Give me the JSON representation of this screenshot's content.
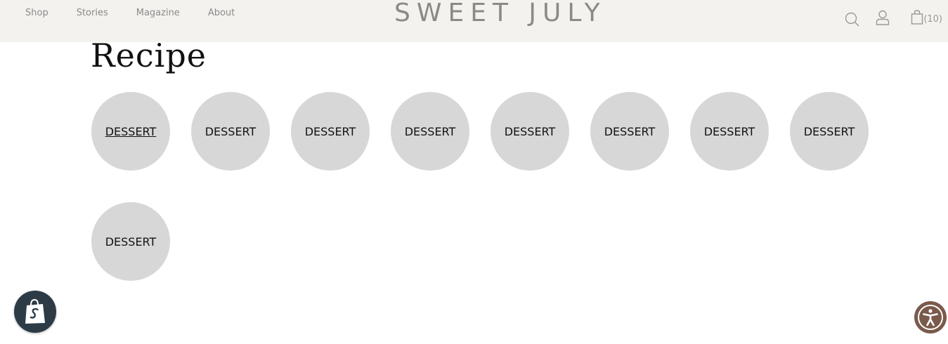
{
  "header": {
    "nav": [
      {
        "label": "Shop"
      },
      {
        "label": "Stories"
      },
      {
        "label": "Magazine"
      },
      {
        "label": "About"
      }
    ],
    "logo": "SWEET JULY",
    "cart_count": "(10)",
    "icons": [
      "search-icon",
      "account-icon",
      "cart-icon"
    ]
  },
  "main": {
    "title": "Recipe",
    "categories": [
      {
        "label": "DESSERT",
        "active": true
      },
      {
        "label": "DESSERT",
        "active": false
      },
      {
        "label": "DESSERT",
        "active": false
      },
      {
        "label": "DESSERT",
        "active": false
      },
      {
        "label": "DESSERT",
        "active": false
      },
      {
        "label": "DESSERT",
        "active": false
      },
      {
        "label": "DESSERT",
        "active": false
      },
      {
        "label": "DESSERT",
        "active": false
      },
      {
        "label": "DESSERT",
        "active": false
      }
    ]
  },
  "widgets": {
    "shopify": "shopify-bag-icon",
    "accessibility": "accessibility-icon"
  },
  "colors": {
    "header_bg": "#f4f2ee",
    "circle_bg": "#d8d7d7",
    "shopify_bg": "#2c3b46",
    "a11y_bg": "#7a5a4b"
  }
}
